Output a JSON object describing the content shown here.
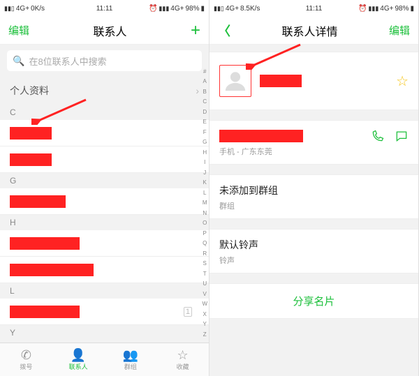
{
  "status": {
    "net_label": "4G+",
    "speed_left": "0K/s",
    "speed_right": "8.5K/s",
    "time": "11:11",
    "battery": "98%"
  },
  "left": {
    "header": {
      "edit": "编辑",
      "title": "联系人",
      "plus": "+"
    },
    "search": {
      "placeholder": "在8位联系人中搜索"
    },
    "profile_row": "个人资料",
    "sections": [
      "C",
      "G",
      "H",
      "L",
      "Y"
    ],
    "index": [
      "#",
      "A",
      "B",
      "C",
      "D",
      "E",
      "F",
      "G",
      "H",
      "I",
      "J",
      "K",
      "L",
      "M",
      "N",
      "O",
      "P",
      "Q",
      "R",
      "S",
      "T",
      "U",
      "V",
      "W",
      "X",
      "Y",
      "Z"
    ],
    "tabs": {
      "dial": "拨号",
      "contacts": "联系人",
      "groups": "群组",
      "fav": "收藏"
    }
  },
  "right": {
    "header": {
      "back": "〈",
      "title": "联系人详情",
      "edit": "编辑"
    },
    "phone_sub": "手机 - 广东东莞",
    "group_title": "未添加到群组",
    "group_sub": "群组",
    "ringtone_title": "默认铃声",
    "ringtone_sub": "铃声",
    "share": "分享名片"
  }
}
